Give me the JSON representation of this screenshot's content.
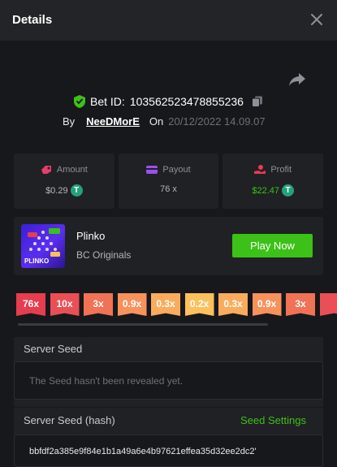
{
  "header": {
    "title": "Details",
    "close_icon": "close-icon"
  },
  "bet": {
    "id_label": "Bet ID:",
    "id": "103562523478855236",
    "by_label": "By",
    "user": "NeeDMorE",
    "on_label": "On",
    "date": "20/12/2022 14.09.07"
  },
  "stats": {
    "amount_label": "Amount",
    "amount_value": "$0.29",
    "payout_label": "Payout",
    "payout_value": "76 x",
    "profit_label": "Profit",
    "profit_value": "$22.47"
  },
  "game": {
    "name": "Plinko",
    "provider": "BC Originals",
    "play_label": "Play Now",
    "thumb_text": "PLINKO"
  },
  "multipliers": [
    "76x",
    "10x",
    "3x",
    "0.9x",
    "0.3x",
    "0.2x",
    "0.3x",
    "0.9x",
    "3x"
  ],
  "multiplier_colors": [
    "#e63d4f",
    "#ea4f55",
    "#f17255",
    "#f8925c",
    "#fbab5c",
    "#fcc05c",
    "#fbab5c",
    "#f8925c",
    "#f17255",
    "#ea4f55"
  ],
  "server_seed": {
    "label": "Server Seed",
    "placeholder": "The Seed hasn't been revealed yet."
  },
  "server_seed_hash": {
    "label": "Server Seed (hash)",
    "settings_label": "Seed Settings",
    "value": "bbfdf2a385e9f84e1b1a49a6e4b97621effea35d32ee2dc2'"
  },
  "colors": {
    "accent": "#3bc117",
    "background": "#17181b",
    "panel": "#202124"
  }
}
